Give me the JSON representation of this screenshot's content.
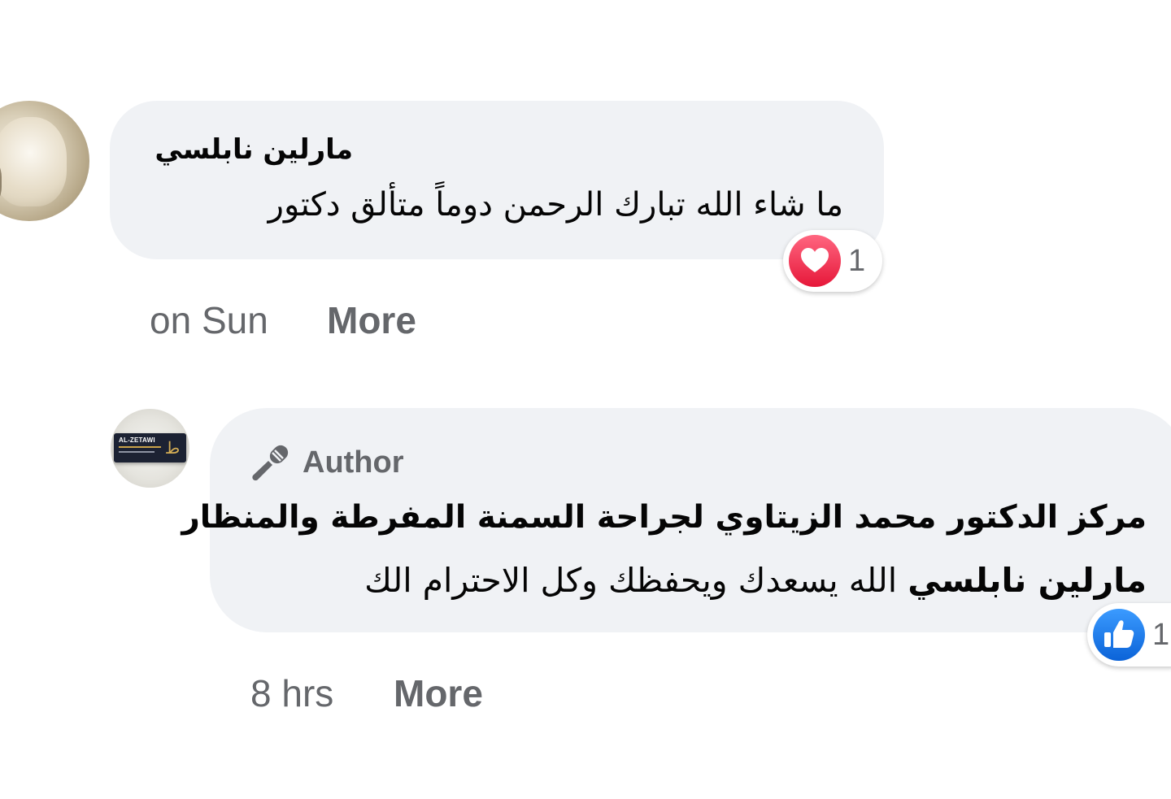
{
  "comments": [
    {
      "author": "مارلين نابلسي",
      "text": "ما شاء الله تبارك الرحمن دوماً متألق دكتور",
      "reaction": {
        "icon": "heart-reaction-icon",
        "count": "1",
        "color": "#f33e58"
      },
      "time": "on Sun",
      "more_label": "More"
    },
    {
      "badge": {
        "icon": "microphone-icon",
        "label": "Author"
      },
      "author": "مركز الدكتور محمد الزيتاوي لجراحة السمنة المفرطة والمنظار",
      "mention": "مارلين نابلسي",
      "text": "الله يسعدك ويحفظك وكل الاحترام الك",
      "avatar_text": "AL-ZETAWI",
      "reaction": {
        "icon": "like-reaction-icon",
        "count": "1",
        "color": "#1877f2"
      },
      "time": "8 hrs",
      "more_label": "More"
    }
  ],
  "colors": {
    "bubble_bg": "#f0f2f5",
    "secondary_text": "#65676b",
    "primary_text": "#050505"
  }
}
